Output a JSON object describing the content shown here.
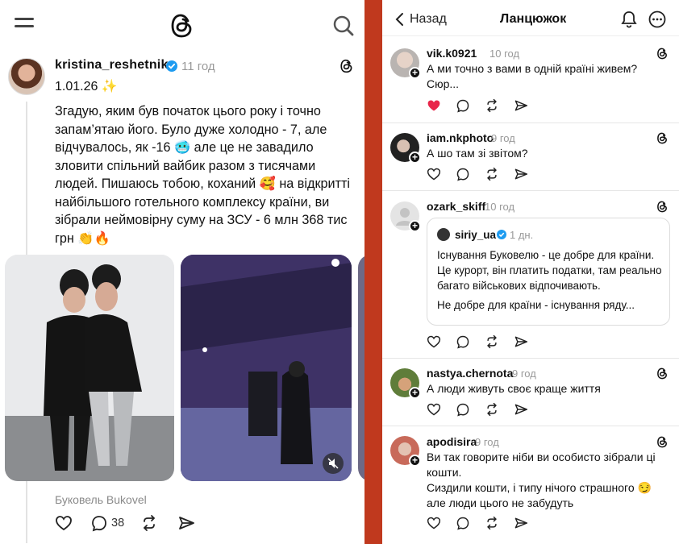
{
  "left_post": {
    "username": "kristina_reshetnik",
    "time": "11 год",
    "date": "1.01.26 ✨",
    "text": "Згадую, яким був початок цього року і точно запам’ятаю його. Було дуже холодно - 7, але відчувалось, як -16 🥶 але це не завадило зловити спільний вайбик разом з тисячами людей. Пишаюсь тобою, коханий 🥰 на відкритті найбільшого готельного комплексу країни, ви зібрали неймовірну суму на ЗСУ - 6 млн 368 тис грн 👏🔥",
    "location": "Буковель Bukovel",
    "reply_count": "38"
  },
  "thread": {
    "back_label": "Назад",
    "title": "Ланцюжок",
    "comments": [
      {
        "username": "vik.k0921",
        "time": "10 год",
        "text": "А ми точно з вами в одній країні живем? Сюр...",
        "liked": true
      },
      {
        "username": "iam.nkphoto",
        "time": "9 год",
        "text": "А шо там зі звітом?"
      },
      {
        "username": "ozark_skiff",
        "time": "10 год",
        "text": ""
      },
      {
        "username": "nastya.chernota",
        "time": "9 год",
        "text": "А люди живуть своє  краще життя"
      },
      {
        "username": "apodisira",
        "time": "9 год",
        "text": "Ви так говорите ніби ви особисто зібрали ці кошти.",
        "text2": "Сиздили кошти, і типу нічого страшного 😏 але люди цього не забудуть"
      }
    ],
    "quote": {
      "username": "siriy_ua",
      "time": "1 дн.",
      "text": "Існування Буковелю - це добре для країни. Це курорт, він платить податки, там реально багато військових відпочивають.",
      "text2": "Не добре для країни - існування ряду..."
    }
  },
  "colors": {
    "divider_red": "#c0391e",
    "like_red": "#e8264a",
    "muted_text": "#999999"
  },
  "icons": [
    "menu-icon",
    "threads-logo-icon",
    "search-icon",
    "heart-icon",
    "reply-icon",
    "repost-icon",
    "share-icon",
    "bell-icon",
    "more-icon",
    "back-chevron-icon",
    "verified-icon",
    "mute-icon"
  ]
}
